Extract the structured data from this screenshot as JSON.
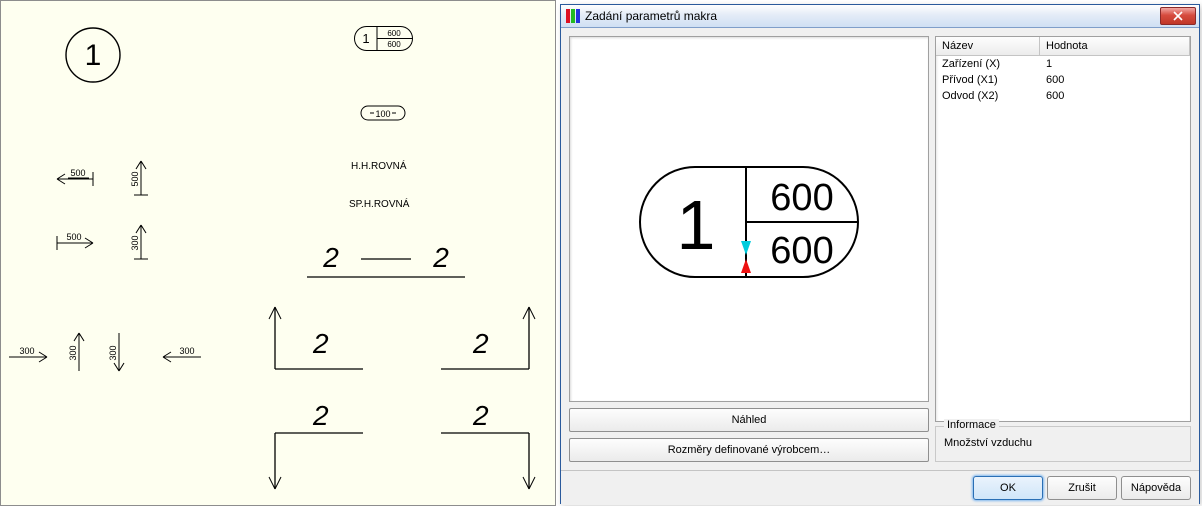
{
  "dialog": {
    "title": "Zadání parametrů makra",
    "preview_btn": "Náhled",
    "dims_btn": "Rozměry definované výrobcem…",
    "grid": {
      "col_name": "Název",
      "col_value": "Hodnota",
      "rows": [
        {
          "name": "Zařízení (X)",
          "value": "1"
        },
        {
          "name": "Přívod (X1)",
          "value": "600"
        },
        {
          "name": "Odvod (X2)",
          "value": "600"
        }
      ]
    },
    "info_legend": "Informace",
    "info_text": "Množství vzduchu",
    "ok": "OK",
    "cancel": "Zrušit",
    "help": "Nápověda"
  },
  "preview": {
    "device": "1",
    "top": "600",
    "bottom": "600"
  },
  "cad": {
    "big_1": "1",
    "pill_1": "1",
    "pill_top": "600",
    "pill_bottom": "600",
    "small_pill": "100",
    "label_hh": "H.H.ROVNÁ",
    "label_sp": "SP.H.ROVNÁ",
    "n500": "500",
    "n300": "300",
    "section_left": "2",
    "section_right": "2",
    "arrow_2": "2"
  }
}
